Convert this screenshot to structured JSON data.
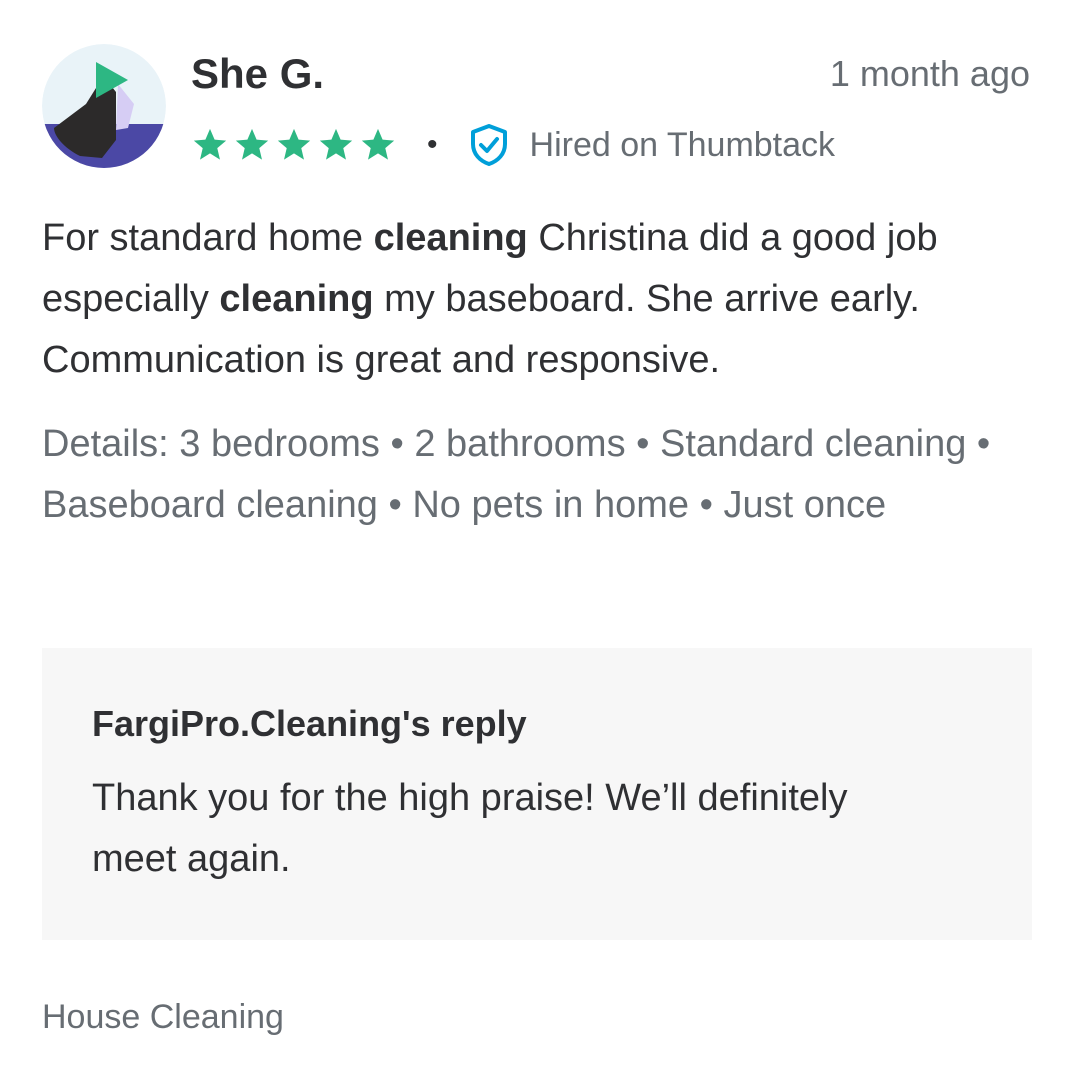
{
  "review": {
    "reviewer_name": "She G.",
    "date": "1 month ago",
    "rating": 5,
    "star_color": "#2db783",
    "separator": "•",
    "verified_label": "Hired on Thumbtack",
    "verified_icon": "shield-check-icon",
    "verified_color": "#009fd9",
    "body_parts": [
      "For standard home ",
      "cleaning",
      " Christina did a good job especially ",
      "cleaning",
      " my baseboard. She arrive early. Communication is great and responsive."
    ],
    "details": "Details: 3 bedrooms • 2 bathrooms • Standard cleaning • Baseboard cleaning • No pets in home • Just once"
  },
  "reply": {
    "title": "FargiPro.Cleaning's reply",
    "text": "Thank you for the high praise! We’ll definitely meet again."
  },
  "category": "House Cleaning"
}
